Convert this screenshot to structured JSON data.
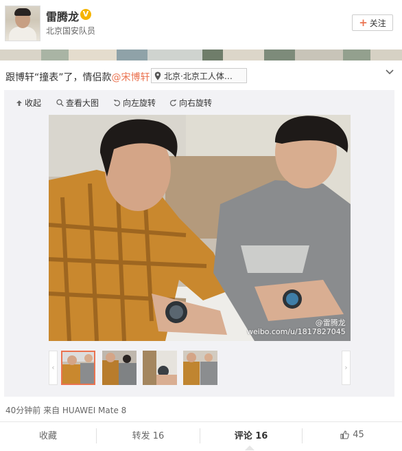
{
  "user": {
    "name": "雷腾龙",
    "verified_badge": "V",
    "verified_text": "北京国安队员"
  },
  "follow_button": {
    "plus": "+",
    "label": "关注"
  },
  "post": {
    "text_before": "跟博轩“撞表”了，情侣款",
    "mention": "@宋博轩",
    "location": "北京·北京工人体…"
  },
  "toolbar": {
    "collapse": "收起",
    "view_large": "查看大图",
    "rotate_left": "向左旋转",
    "rotate_right": "向右旋转"
  },
  "watermark": {
    "handle": "@雷腾龙",
    "url": "weibo.com/u/1817827045"
  },
  "thumbnails": {
    "prev": "‹",
    "next": "›",
    "count": 4,
    "active_index": 0
  },
  "meta": {
    "time_source": "40分钟前 来自 HUAWEI Mate 8"
  },
  "actions": {
    "favorite": "收藏",
    "repost": "转发 16",
    "comment": "评论 16",
    "like_count": "45"
  },
  "colors": {
    "accent": "#eb7350",
    "panel_bg": "#f2f2f5",
    "badge": "#f5b400"
  }
}
